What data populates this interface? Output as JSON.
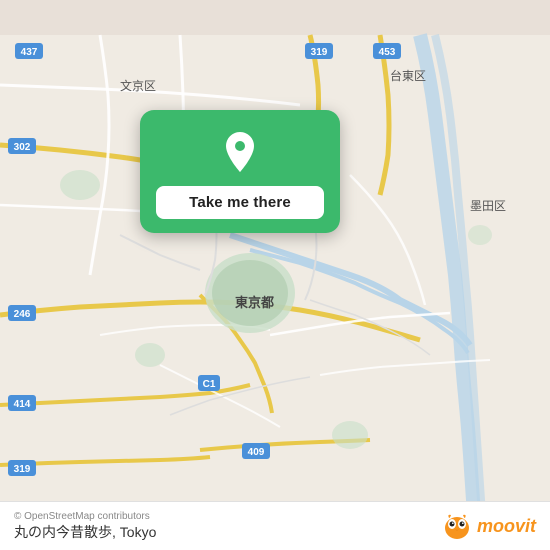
{
  "map": {
    "attribution": "© OpenStreetMap contributors",
    "bg_color": "#e8e0d8"
  },
  "popup": {
    "button_label": "Take me there",
    "pin_color": "#ffffff"
  },
  "bottom_bar": {
    "copyright": "© OpenStreetMap contributors",
    "place_name": "丸の内今昔散歩, Tokyo",
    "logo_text": "moovit"
  }
}
